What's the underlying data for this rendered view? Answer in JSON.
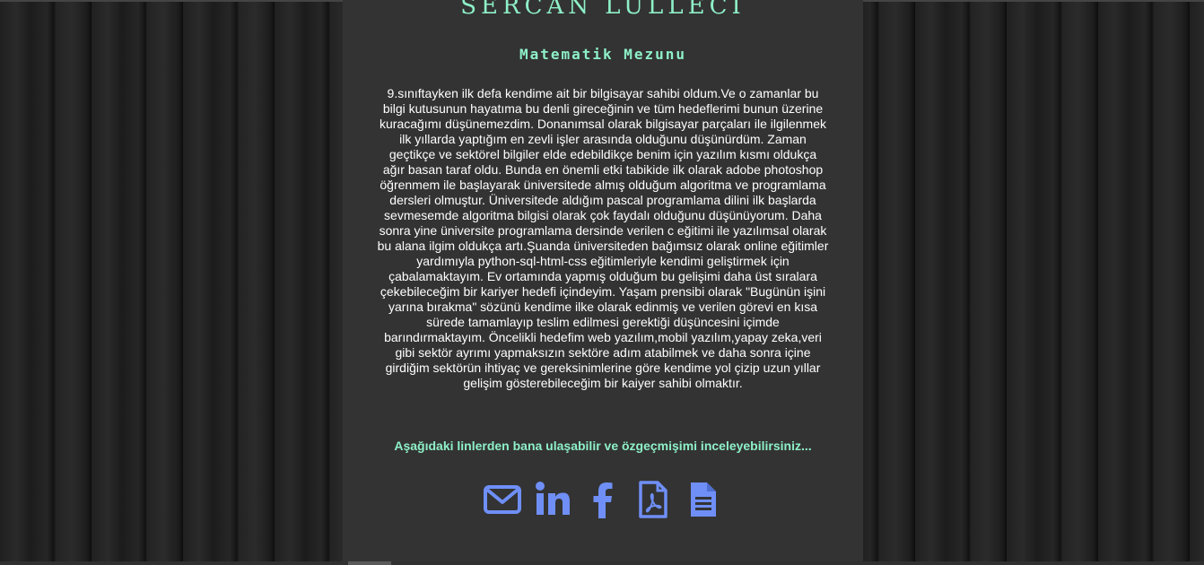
{
  "profile": {
    "name": "SERCAN LULLECİ",
    "title": "Matematik Mezunu",
    "bio": "9.sınıftayken ilk defa kendime ait bir bilgisayar sahibi oldum.Ve o zamanlar bu bilgi kutusunun hayatıma bu denli gireceğinin ve tüm hedeflerimi bunun üzerine kuracağımı düşünemezdim. Donanımsal olarak bilgisayar parçaları ile ilgilenmek ilk yıllarda yaptığım en zevli işler arasında olduğunu düşünürdüm. Zaman geçtikçe ve sektörel bilgiler elde edebildikçe benim için yazılım kısmı oldukça ağır basan taraf oldu. Bunda en önemli etki tabikide ilk olarak adobe photoshop öğrenmem ile başlayarak üniversitede almış olduğum algoritma ve programlama dersleri olmuştur. Üniversitede aldığım pascal programlama dilini ilk başlarda sevmesemde algoritma bilgisi olarak çok faydalı olduğunu düşünüyorum. Daha sonra yine üniversite programlama dersinde verilen c eğitimi ile yazılımsal olarak bu alana ilgim oldukça artı.Şuanda üniversiteden bağımsız olarak online eğitimler yardımıyla python-sql-html-css eğitimleriyle kendimi geliştirmek için çabalamaktayım. Ev ortamında yapmış olduğum bu gelişimi daha üst sıralara çekebileceğim bir kariyer hedefi içindeyim. Yaşam prensibi olarak \"Bugünün işini yarına bırakma\" sözünü kendime ilke olarak edinmiş ve verilen görevi en kısa sürede tamamlayıp teslim edilmesi gerektiği düşüncesini içimde barındırmaktayım. Öncelikli hedefim web yazılım,mobil yazılım,yapay zeka,veri gibi sektör ayrımı yapmaksızın sektöre adım atabilmek ve daha sonra içine girdiğim sektörün ihtiyaç ve gereksinimlerine göre kendime yol çizip uzun yıllar gelişim gösterebileceğim bir kaiyer sahibi olmaktır.",
    "contact_text": "Aşağıdaki linlerden bana ulaşabilir ve özgeçmişimi inceleyebilirsiniz..."
  },
  "links": [
    {
      "icon": "envelope-icon"
    },
    {
      "icon": "linkedin-icon"
    },
    {
      "icon": "facebook-icon"
    },
    {
      "icon": "pdf-file-icon"
    },
    {
      "icon": "document-file-icon"
    }
  ],
  "colors": {
    "accent": "#8ef0c8",
    "icon": "#6f8ff7",
    "panel": "#333333",
    "text": "#ffffff"
  }
}
